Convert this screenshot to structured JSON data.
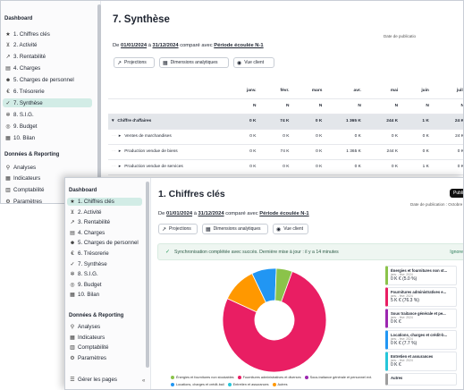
{
  "back": {
    "sidebar": {
      "section_dashboard": "Dashboard",
      "items": [
        {
          "label": "1. Chiffres clés",
          "icon": "star-icon",
          "glyph": "★"
        },
        {
          "label": "2. Activité",
          "icon": "cart-icon",
          "glyph": "⊻"
        },
        {
          "label": "3. Rentabilité",
          "icon": "trend-icon",
          "glyph": "↗"
        },
        {
          "label": "4. Charges",
          "icon": "receipt-icon",
          "glyph": "▤"
        },
        {
          "label": "5. Charges de personnel",
          "icon": "people-icon",
          "glyph": "☻"
        },
        {
          "label": "6. Trésorerie",
          "icon": "euro-icon",
          "glyph": "€"
        },
        {
          "label": "7. Synthèse",
          "icon": "check-circle-icon",
          "glyph": "✓"
        },
        {
          "label": "8. S.I.G.",
          "icon": "settings-icon",
          "glyph": "✲"
        },
        {
          "label": "9. Budget",
          "icon": "target-icon",
          "glyph": "◎"
        },
        {
          "label": "10. Bilan",
          "icon": "table-icon",
          "glyph": "▦"
        }
      ],
      "section_data": "Données & Reporting",
      "data_items": [
        {
          "label": "Analyses",
          "icon": "pin-icon",
          "glyph": "⚲"
        },
        {
          "label": "Indicateurs",
          "icon": "grid-icon",
          "glyph": "▦"
        },
        {
          "label": "Comptabilité",
          "icon": "ledger-icon",
          "glyph": "▥"
        },
        {
          "label": "Paramètres",
          "icon": "gear-icon",
          "glyph": "⚙"
        }
      ]
    },
    "title": "7. Synthèse",
    "period": {
      "prefix": "De",
      "start": "01/01/2024",
      "to": "à",
      "end": "31/12/2024",
      "compared": "comparé avec",
      "compare_period": "Période écoulée N-1"
    },
    "pub_date": "Date de publicatio",
    "toolbar": [
      {
        "label": "Projections",
        "icon": "trend-icon",
        "glyph": "↗"
      },
      {
        "label": "Dimensions analytiques",
        "icon": "table-icon",
        "glyph": "▦"
      },
      {
        "label": "Vue client",
        "icon": "eye-icon",
        "glyph": "◉"
      }
    ],
    "table": {
      "months": [
        "janv.",
        "févr.",
        "mars",
        "avr.",
        "mai",
        "juin",
        "juil."
      ],
      "subheader": [
        "N",
        "N",
        "N",
        "N",
        "N",
        "N",
        "N"
      ],
      "rows": [
        {
          "label": "Chiffre d'affaires",
          "type": "group",
          "values": [
            "0 K",
            "74 K",
            "0 K",
            "1 365 K",
            "244 K",
            "1 K",
            "24 K"
          ]
        },
        {
          "label": "Ventes de marchandises",
          "type": "child",
          "values": [
            "0 K",
            "0 K",
            "0 K",
            "0 K",
            "0 K",
            "0 K",
            "24 K"
          ]
        },
        {
          "label": "Production vendue de biens",
          "type": "child",
          "values": [
            "0 K",
            "74 K",
            "0 K",
            "1 365 K",
            "244 K",
            "0 K",
            "0 K"
          ]
        },
        {
          "label": "Production vendue de services",
          "type": "child",
          "values": [
            "0 K",
            "0 K",
            "0 K",
            "0 K",
            "0 K",
            "1 K",
            "0 K"
          ]
        }
      ]
    }
  },
  "front": {
    "sidebar": {
      "section_dashboard": "Dashboard",
      "items": [
        {
          "label": "1. Chiffres clés",
          "icon": "star-icon",
          "glyph": "★"
        },
        {
          "label": "2. Activité",
          "icon": "cart-icon",
          "glyph": "⊻"
        },
        {
          "label": "3. Rentabilité",
          "icon": "trend-icon",
          "glyph": "↗"
        },
        {
          "label": "4. Charges",
          "icon": "receipt-icon",
          "glyph": "▤"
        },
        {
          "label": "5. Charges de personnel",
          "icon": "people-icon",
          "glyph": "☻"
        },
        {
          "label": "6. Trésorerie",
          "icon": "euro-icon",
          "glyph": "€"
        },
        {
          "label": "7. Synthèse",
          "icon": "check-circle-icon",
          "glyph": "✓"
        },
        {
          "label": "8. S.I.G.",
          "icon": "settings-icon",
          "glyph": "✲"
        },
        {
          "label": "9. Budget",
          "icon": "target-icon",
          "glyph": "◎"
        },
        {
          "label": "10. Bilan",
          "icon": "table-icon",
          "glyph": "▦"
        }
      ],
      "section_data": "Données & Reporting",
      "data_items": [
        {
          "label": "Analyses",
          "icon": "pin-icon",
          "glyph": "⚲"
        },
        {
          "label": "Indicateurs",
          "icon": "grid-icon",
          "glyph": "▦"
        },
        {
          "label": "Comptabilité",
          "icon": "ledger-icon",
          "glyph": "▥"
        },
        {
          "label": "Paramètres",
          "icon": "gear-icon",
          "glyph": "⚙"
        }
      ],
      "footer": {
        "label": "Gérer les pages",
        "icon": "pages-icon",
        "glyph": "☰",
        "collapse_glyph": "«"
      }
    },
    "title": "1. Chiffres clés",
    "publish_label": "Publi",
    "period": {
      "prefix": "De",
      "start": "01/01/2024",
      "to": "à",
      "end": "31/12/2024",
      "compared": "comparé avec",
      "compare_period": "Période écoulée N-1"
    },
    "pub_date": "Date de publication : Octobre",
    "toolbar": [
      {
        "label": "Projections",
        "icon": "trend-icon",
        "glyph": "↗"
      },
      {
        "label": "Dimensions analytiques",
        "icon": "table-icon",
        "glyph": "▦"
      },
      {
        "label": "Vue client",
        "icon": "eye-icon",
        "glyph": "◉"
      }
    ],
    "sync": {
      "message": "Synchronisation complétée avec succès. Dernière mise à jour : il y a 14 minutes",
      "action": "Ignore",
      "icon": "check-icon",
      "glyph": "✓"
    },
    "cards": [
      {
        "title": "Énergies et fournitures non st...",
        "sub": "janv. - févr. 2024",
        "value": "0 K € (5.0 %)",
        "color": "#8bc34a"
      },
      {
        "title": "Fournitures administratives e...",
        "sub": "janv. - févr. 2024",
        "value": "5 K € (76.3 %)",
        "color": "#e91e63"
      },
      {
        "title": "Sous traitance générale et pe...",
        "sub": "janv. - févr. 2024",
        "value": "0 K €",
        "color": "#9c27b0"
      },
      {
        "title": "Locations, charges et crédit-b...",
        "sub": "janv. - févr. 2024",
        "value": "0 K € (7.7 %)",
        "color": "#2196f3"
      },
      {
        "title": "Entretien et assurances",
        "sub": "janv. - févr. 2024",
        "value": "0 K €",
        "color": "#26c6da"
      },
      {
        "title": "Autres",
        "sub": "",
        "value": "",
        "color": "#9e9e9e"
      }
    ]
  },
  "chart_data": {
    "type": "pie",
    "style": "donut",
    "series": [
      {
        "name": "Énergies et fournitures non stockables",
        "value": 5.0,
        "color": "#8bc34a"
      },
      {
        "name": "Fournitures administratives et diverses",
        "value": 76.3,
        "color": "#e91e63"
      },
      {
        "name": "Sous-traitance générale et personnel ext.",
        "value": 0.0,
        "color": "#9c27b0"
      },
      {
        "name": "Locations, charges et crédit-bail",
        "value": 7.7,
        "color": "#2196f3"
      },
      {
        "name": "Entretien et assurances",
        "value": 0.0,
        "color": "#26c6da"
      },
      {
        "name": "Autres",
        "value": 11.0,
        "color": "#ff9800"
      }
    ],
    "legend_placement": "bottom"
  }
}
